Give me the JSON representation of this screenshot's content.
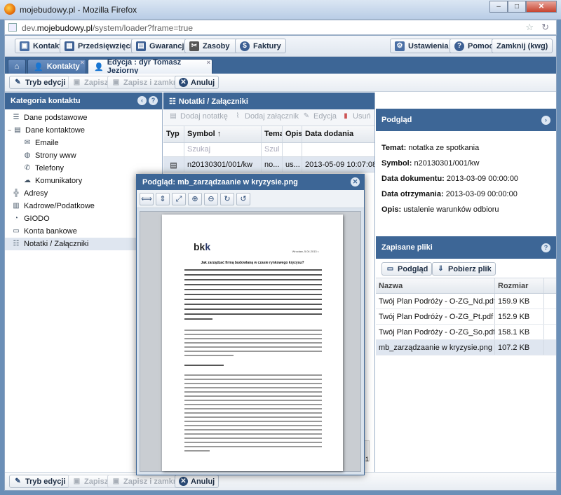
{
  "window": {
    "title": "mojebudowy.pl - Mozilla Firefox",
    "url_prefix": "dev.",
    "url_domain": "mojebudowy.pl",
    "url_path": "/system/loader?frame=true",
    "min": "–",
    "max": "□",
    "close": "✕"
  },
  "topnav": {
    "kontakty": "Kontakty",
    "przedsiewziecia": "Przedsięwzięcia",
    "gwarancje": "Gwarancje",
    "zasoby": "Zasoby",
    "faktury": "Faktury",
    "ustawienia": "Ustawienia",
    "pomoc": "Pomoc",
    "zamknij": "Zamknij (kwg)"
  },
  "tabs": {
    "home_icon": "home-icon",
    "kontakty": "Kontakty",
    "edycja": "Edycja : dyr Tomasz Jeziorny"
  },
  "toolbar": {
    "tryb_edycji": "Tryb edycji",
    "zapisz": "Zapisz",
    "zapisz_zamknij": "Zapisz i zamknij",
    "anuluj": "Anuluj"
  },
  "left": {
    "title": "Kategoria kontaktu",
    "items": [
      "Dane podstawowe",
      "Dane kontaktowe",
      "Emaile",
      "Strony www",
      "Telefony",
      "Komunikatory",
      "Adresy",
      "Kadrowe/Podatkowe",
      "GIODO",
      "Konta bankowe",
      "Notatki / Załączniki"
    ]
  },
  "middle": {
    "title": "Notatki / Załączniki",
    "btn_add_note": "Dodaj notatkę",
    "btn_add_attachment": "Dodaj załącznik",
    "btn_edit": "Edycja",
    "btn_delete": "Usuń",
    "columns": [
      "Typ",
      "Symbol ↑",
      "Temat",
      "Opis",
      "Data dodania"
    ],
    "filter_placeholder_symbol": "Szukaj",
    "filter_placeholder_temat": "Szul",
    "row": {
      "symbol": "n20130301/001/kw",
      "temat": "no...",
      "opis": "us...",
      "data": "2013-05-09 10:07:08"
    }
  },
  "preview": {
    "title": "Podgląd",
    "temat_label": "Temat:",
    "temat_value": "notatka ze spotkania",
    "symbol_label": "Symbol:",
    "symbol_value": "n20130301/001/kw",
    "data_dok_label": "Data dokumentu:",
    "data_dok_value": "2013-03-09 00:00:00",
    "data_otrz_label": "Data otrzymania:",
    "data_otrz_value": "2013-03-09 00:00:00",
    "opis_label": "Opis:",
    "opis_value": "ustalenie warunków odbioru"
  },
  "files": {
    "title": "Zapisane pliki",
    "btn_preview": "Podgląd",
    "btn_download": "Pobierz plik",
    "col_name": "Nazwa",
    "col_size": "Rozmiar",
    "rows": [
      {
        "name": "Twój Plan Podróży - O-ZG_Nd.pdf",
        "size": "159.9 KB"
      },
      {
        "name": "Twój Plan Podróży - O-ZG_Pt.pdf",
        "size": "152.9 KB"
      },
      {
        "name": "Twój Plan Podróży - O-ZG_So.pdf",
        "size": "158.1 KB"
      },
      {
        "name": "mb_zarządzaanie w kryzysie.png",
        "size": "107.2 KB"
      }
    ]
  },
  "dialog": {
    "title": "Podgląd: mb_zarządzaanie w kryzysie.png",
    "doc_logo": "bk",
    "doc_logo_suffix": "k",
    "doc_date": "Wrocław, 5.04.2013 r.",
    "doc_title": "Jak zarządzać firmą budowlaną w czasie rynkowego kryzysu?"
  },
  "pager": {
    "page": "1"
  }
}
